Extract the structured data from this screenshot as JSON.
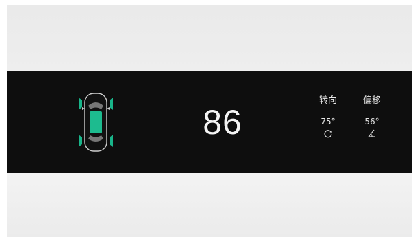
{
  "display": {
    "speed": "86",
    "steering": {
      "label": "转向",
      "value": "75°",
      "icon": "rotate-icon"
    },
    "offset": {
      "label": "偏移",
      "value": "56°",
      "icon": "angle-icon"
    },
    "vehicle_icon": "car-top-view-icon",
    "colors": {
      "background": "#0e0e0e",
      "accent": "#19b58a",
      "text": "#f4f4f4"
    }
  }
}
